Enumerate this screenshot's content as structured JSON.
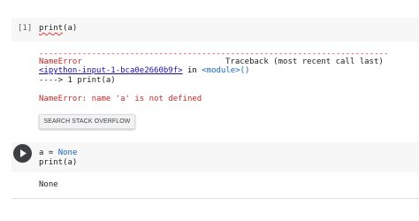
{
  "cell1": {
    "execution_count": "[1]",
    "code_fn": "print",
    "code_args": "(a)",
    "traceback": {
      "dashes": "-------------------------------------------------------------------------",
      "error_name": "NameError",
      "header_right": "Traceback (most recent call last)",
      "input_link": "<ipython-input-1-bca0e2660b9f>",
      "in_text": " in ",
      "module_link": "<module>()",
      "arrow_line": "----> 1 print(a)",
      "error_message": "NameError: name 'a' is not defined"
    },
    "search_button_label": "SEARCH STACK OVERFLOW"
  },
  "cell2": {
    "code_line1_var": "a = ",
    "code_line1_val": "None",
    "code_line2": "print(a)",
    "output": "None"
  },
  "colors": {
    "error": "#c62828",
    "link": "#1a0dab",
    "keyword": "#1565c0",
    "cell_bg": "#f7f7f7"
  },
  "icons": {
    "run": "play-icon"
  }
}
